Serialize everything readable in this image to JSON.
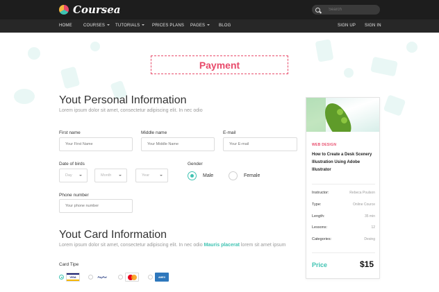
{
  "header": {
    "brand": "Coursea",
    "search_placeholder": "Search",
    "nav": [
      {
        "label": "HOME"
      },
      {
        "label": "COURSES"
      },
      {
        "label": "TUTORIALS"
      },
      {
        "label": "PRICES PLANS"
      },
      {
        "label": "PAGES"
      },
      {
        "label": "BLOG"
      }
    ],
    "sign_up": "SIGN UP",
    "sign_in": "SIGN IN"
  },
  "page": {
    "title": "Payment"
  },
  "personal": {
    "heading": "Yout Personal Information",
    "subtitle": "Lorem ipsum dolor sit amet, consectetur adipiscing elit. In nec odio",
    "first_name_label": "First name",
    "first_name_placeholder": "Your First Name",
    "middle_name_label": "Middle name",
    "middle_name_placeholder": "Your Middle Name",
    "email_label": "E-mail",
    "email_placeholder": "Your E-mail",
    "dob_label": "Date of birds",
    "day": "Day",
    "month": "Month",
    "year": "Year",
    "gender_label": "Gender",
    "gender_male": "Male",
    "gender_female": "Female",
    "gender_selected": "Male",
    "phone_label": "Phone number",
    "phone_placeholder": "Your phone number"
  },
  "card": {
    "heading": "Yout Card Information",
    "subtitle_before": "Lorem ipsum dolor sit amet, consectetur adipiscing elit. In nec odio",
    "subtitle_link": "Mauris placerat",
    "subtitle_after": "lorem sit amet ipsum",
    "card_type_label": "Card Tipe",
    "types": [
      "VISA",
      "PayPal",
      "MasterCard",
      "AMERICAN EXPRESS"
    ],
    "selected_type": "VISA"
  },
  "course": {
    "category": "WEB DESIGN",
    "title": "How to Create a Desk Scenery Illustration Using Adobe Illustrator",
    "meta": [
      {
        "key": "Instructor:",
        "value": "Rebeca Poulson"
      },
      {
        "key": "Type:",
        "value": "Online Cource"
      },
      {
        "key": "Length:",
        "value": "35 min"
      },
      {
        "key": "Lessons:",
        "value": "12"
      },
      {
        "key": "Categories:",
        "value": "Desing"
      }
    ],
    "price_label": "Price",
    "price": "$15"
  },
  "colors": {
    "accent": "#3fc3b2",
    "brand_pink": "#e84a6a",
    "topbar": "#1d1d1d",
    "navbar": "#272727"
  }
}
